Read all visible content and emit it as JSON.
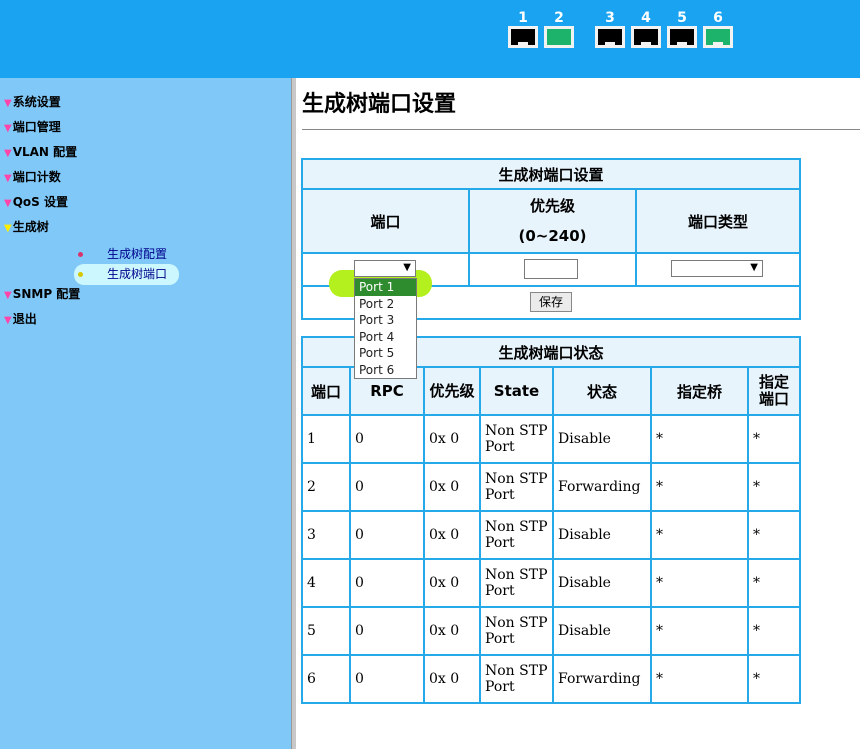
{
  "ports": [
    {
      "label": "1",
      "color": "#000000"
    },
    {
      "label": "2",
      "color": "#1db36b"
    },
    {
      "label": "3",
      "color": "#000000"
    },
    {
      "label": "4",
      "color": "#000000"
    },
    {
      "label": "5",
      "color": "#000000"
    },
    {
      "label": "6",
      "color": "#1db36b"
    }
  ],
  "sidebar": {
    "menu": [
      {
        "label": "系统设置"
      },
      {
        "label": "端口管理"
      },
      {
        "label": "VLAN 配置"
      },
      {
        "label": "端口计数"
      },
      {
        "label": "QoS 设置"
      },
      {
        "label": "生成树"
      },
      {
        "label": "SNMP 配置"
      },
      {
        "label": "退出"
      }
    ],
    "submenu": [
      {
        "label": "生成树配置"
      },
      {
        "label": "生成树端口"
      }
    ]
  },
  "page_title": "生成树端口设置",
  "settings": {
    "caption": "生成树端口设置",
    "col_port": "端口",
    "col_priority": "优先级",
    "col_priority_range": "(0~240)",
    "col_type": "端口类型",
    "save_label": "保存",
    "port_select_value": "",
    "priority_value": "",
    "type_select_value": "",
    "port_options": [
      "Port 1",
      "Port 2",
      "Port 3",
      "Port 4",
      "Port 5",
      "Port 6"
    ],
    "port_option_selected": "Port 1"
  },
  "status": {
    "caption": "生成树端口状态",
    "headers": [
      "端口",
      "RPC",
      "优先级",
      "State",
      "状态",
      "指定桥",
      "指定端口"
    ],
    "rows": [
      [
        "1",
        "0",
        "0x 0",
        "Non STP Port",
        "Disable",
        "*",
        "*"
      ],
      [
        "2",
        "0",
        "0x 0",
        "Non STP Port",
        "Forwarding",
        "*",
        "*"
      ],
      [
        "3",
        "0",
        "0x 0",
        "Non STP Port",
        "Disable",
        "*",
        "*"
      ],
      [
        "4",
        "0",
        "0x 0",
        "Non STP Port",
        "Disable",
        "*",
        "*"
      ],
      [
        "5",
        "0",
        "0x 0",
        "Non STP Port",
        "Disable",
        "*",
        "*"
      ],
      [
        "6",
        "0",
        "0x 0",
        "Non STP Port",
        "Forwarding",
        "*",
        "*"
      ]
    ]
  }
}
